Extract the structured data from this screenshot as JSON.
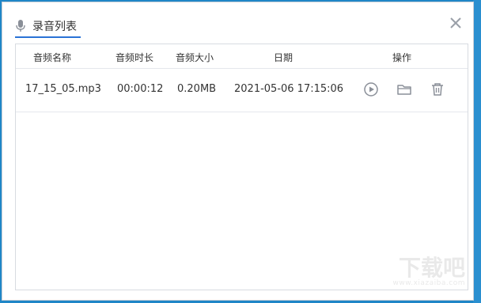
{
  "dialog": {
    "title": "录音列表"
  },
  "table": {
    "headers": [
      "音频名称",
      "音频时长",
      "音频大小",
      "日期",
      "操作"
    ],
    "rows": [
      {
        "name": "17_15_05.mp3",
        "duration": "00:00:12",
        "size": "0.20MB",
        "date": "2021-05-06 17:15:06"
      }
    ]
  },
  "actions": [
    "play-icon",
    "folder-icon",
    "trash-icon"
  ],
  "watermark": {
    "text": "下载吧",
    "url": "www.xiazaiba.com"
  },
  "colors": {
    "background": "#1f86c7",
    "accent": "#2a72d6",
    "text": "#333333",
    "icon": "#8a8f98"
  }
}
